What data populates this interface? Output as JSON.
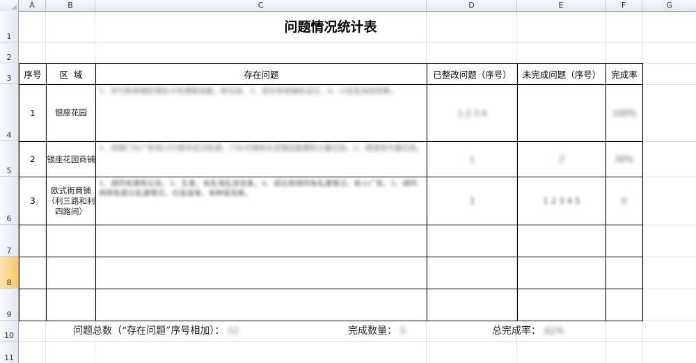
{
  "spreadsheet": {
    "columns": [
      "A",
      "B",
      "C",
      "D",
      "E",
      "F",
      "G"
    ],
    "rows": [
      "1",
      "2",
      "3",
      "4",
      "5",
      "6",
      "7",
      "8",
      "9",
      "10",
      "11"
    ],
    "selected_row": "8"
  },
  "sheet": {
    "title": "问题情况统计表",
    "headers": {
      "index": "序号",
      "area": "区  域",
      "issues": "存在问题",
      "fixed": "已整改问题（序号）",
      "unfinished": "未完成问题（序号）",
      "rate": "完成率"
    },
    "rows": [
      {
        "index": "1",
        "area": "银座花园",
        "issue_text": "1、步行街商铺后墙处卡东通来加盖，有垃圾。3、宜在有商铺处设立。4、小区乱张贴现象。",
        "fixed": "1 2 3 4",
        "unfinished": "",
        "rate": "100%"
      },
      {
        "index": "2",
        "area": "银座花园商铺",
        "issue_text": "1、商铺门头广告有LED屏未创卫标语，门头与墙体水泥墙后面通有大量垃圾，2、楼道有大量垃圾。",
        "fixed": "1",
        "unfinished": "2",
        "rate": "50%"
      },
      {
        "index": "3",
        "area": "欧式街商铺（利三路和利四路间）",
        "issue_text": "1、胡同有建筑垃圾。3、生差，有乱堆乱放现象。4、胡北侧胡同有乱建情况，有小广告。5、胡同两侧有部分乱建情况，垃圾成堆，有种菜现象。",
        "fixed": "1",
        "unfinished": "1 2 3 4 5",
        "rate": "0"
      }
    ],
    "footer": {
      "total_label": "问题总数（“存在问题”序号相加）：",
      "total_value": "12",
      "done_label": "完成数量：",
      "done_value": "5",
      "rate_label": "总完成率：",
      "rate_value": "42%"
    }
  }
}
